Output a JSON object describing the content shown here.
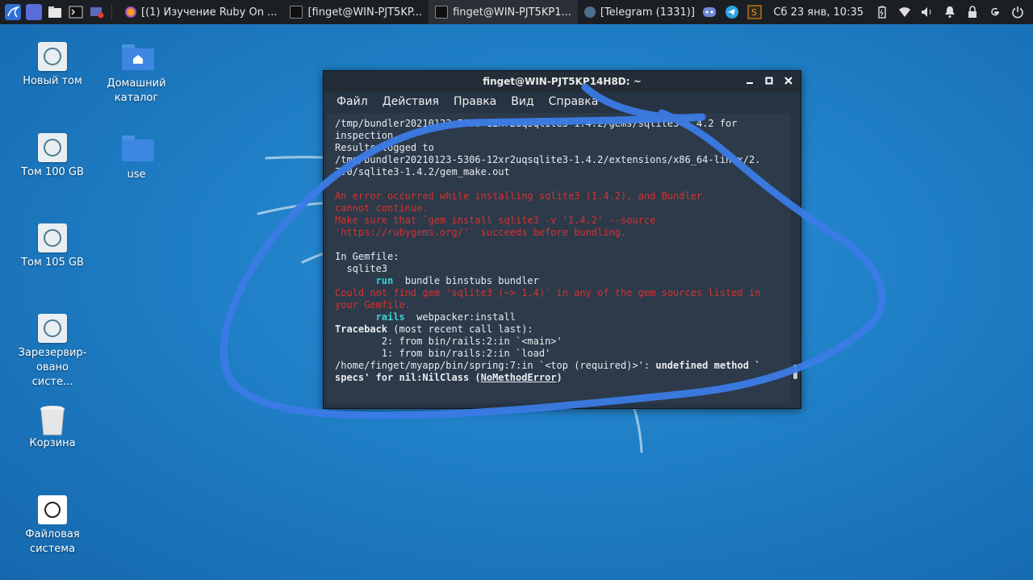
{
  "taskbar": {
    "tasks": [
      {
        "label": "[(1) Изучение Ruby On ...",
        "icon": "firefox-icon"
      },
      {
        "label": "[finget@WIN-PJT5KP...",
        "icon": "terminal-icon"
      },
      {
        "label": "finget@WIN-PJT5KP1...",
        "icon": "terminal-icon"
      },
      {
        "label": "[Telegram (1331)]",
        "icon": "telegram-icon"
      }
    ],
    "clock": "Сб 23 янв, 10:35"
  },
  "desktop": {
    "icons": [
      {
        "label": "Новый том"
      },
      {
        "label": "Домашний каталог"
      },
      {
        "label": "Том 100 GB"
      },
      {
        "label": "use"
      },
      {
        "label": "Том 105 GB"
      },
      {
        "label": "Зарезервир-овано систе..."
      },
      {
        "label": "Корзина"
      },
      {
        "label": "Файловая система"
      }
    ]
  },
  "terminal": {
    "title": "finget@WIN-PJT5KP14H8D: ~",
    "menu": [
      "Файл",
      "Действия",
      "Правка",
      "Вид",
      "Справка"
    ],
    "lines": {
      "l1": "/tmp/bundler20210123-5306-12xr2uqsqlite3-1.4.2/gems/sqlite3-1.4.2 for",
      "l2": "inspection.",
      "l3": "Results logged to",
      "l4": "/tmp/bundler20210123-5306-12xr2uqsqlite3-1.4.2/extensions/x86_64-linux/2.",
      "l5": "7.0/sqlite3-1.4.2/gem_make.out",
      "l7": "An error occurred while installing sqlite3 (1.4.2), and Bundler",
      "l8": "cannot continue.",
      "l9": "Make sure that `gem install sqlite3 -v '1.4.2' --source",
      "l10": "'https://rubygems.org/'` succeeds before bundling.",
      "l12": "In Gemfile:",
      "l13": "  sqlite3",
      "l14_cmd": "run",
      "l14_rest": "  bundle binstubs bundler",
      "l15": "Could not find gem 'sqlite3 (~> 1.4)' in any of the gem sources listed in",
      "l16": "your Gemfile.",
      "l17_cmd": "rails",
      "l17_rest": "  webpacker:install",
      "l18_a": "Traceback",
      "l18_b": " (most recent call last):",
      "l19": "        2: from bin/rails:2:in `<main>'",
      "l20": "        1: from bin/rails:2:in `load'",
      "l21_a": "/home/finget/myapp/bin/spring:7:in `<top (required)>': ",
      "l21_b": "undefined method `",
      "l22_a": "specs' for nil:NilClass (",
      "l22_b": "NoMethodError",
      "l22_c": ")"
    }
  },
  "colors": {
    "error_red": "#d9312f",
    "cmd_cyan": "#3fd0d6",
    "ink_blue": "#3b7be6",
    "taskbar_bg": "#1b1f24",
    "terminal_bg": "#2c3a4a"
  }
}
